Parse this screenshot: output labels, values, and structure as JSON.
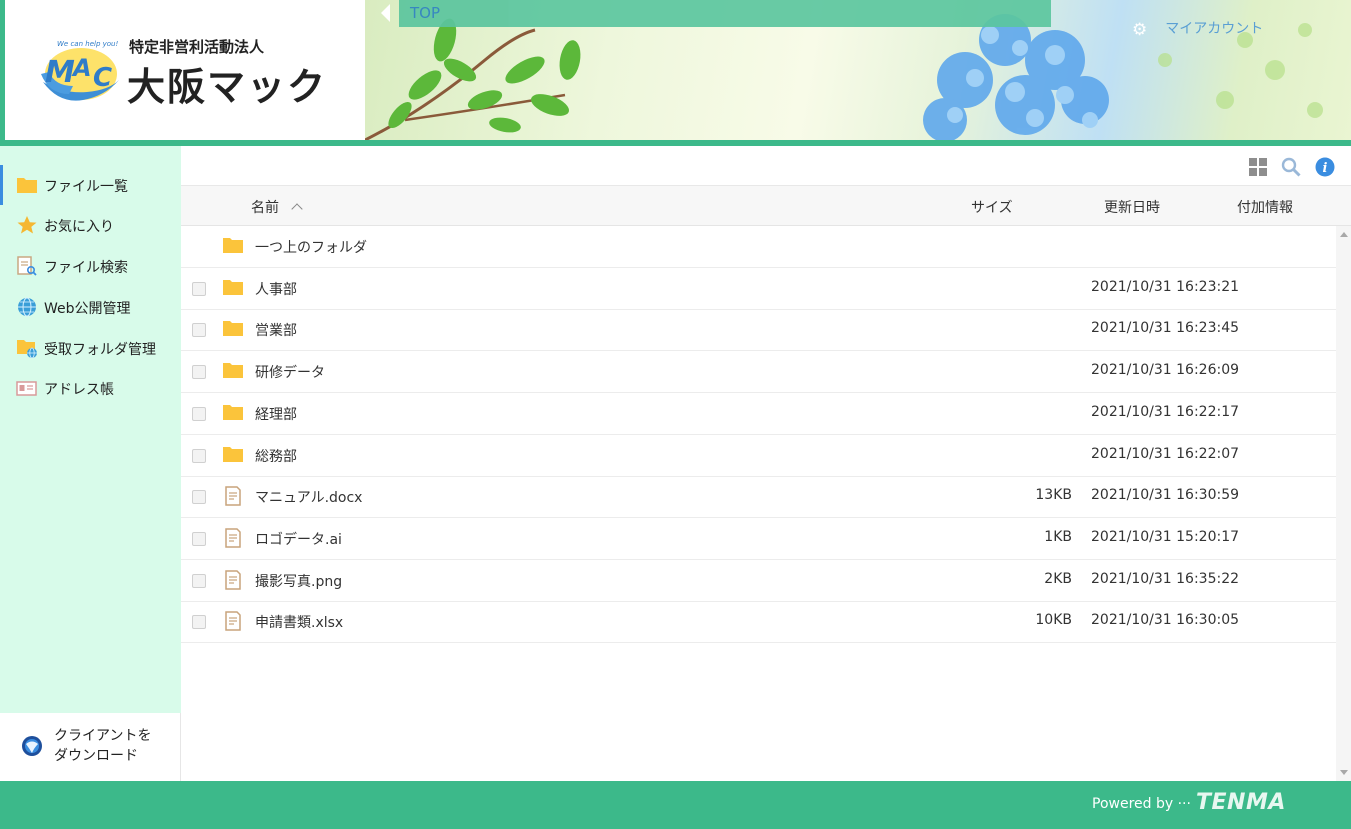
{
  "header": {
    "org_type": "特定非営利活動法人",
    "org_name": "大阪マック",
    "logo_tagline": "We can help you!",
    "top_label": "TOP",
    "account_label": "マイアカウント"
  },
  "sidebar": {
    "items": [
      {
        "label": "ファイル一覧",
        "icon": "folder-icon",
        "active": true
      },
      {
        "label": "お気に入り",
        "icon": "star-icon"
      },
      {
        "label": "ファイル検索",
        "icon": "file-search-icon"
      },
      {
        "label": "Web公開管理",
        "icon": "globe-icon"
      },
      {
        "label": "受取フォルダ管理",
        "icon": "inbox-folder-icon"
      },
      {
        "label": "アドレス帳",
        "icon": "address-book-icon"
      }
    ],
    "client_download": "クライアントをダウンロード"
  },
  "toolbar": {
    "icons": [
      "grid-view-icon",
      "search-icon",
      "info-icon"
    ]
  },
  "columns": {
    "name": "名前",
    "size": "サイズ",
    "updated": "更新日時",
    "extra": "付加情報"
  },
  "files": [
    {
      "name": "一つ上のフォルダ",
      "type": "folder",
      "size": "",
      "updated": "",
      "parent": true
    },
    {
      "name": "人事部",
      "type": "folder",
      "size": "",
      "updated": "2021/10/31 16:23:21"
    },
    {
      "name": "営業部",
      "type": "folder",
      "size": "",
      "updated": "2021/10/31 16:23:45"
    },
    {
      "name": "研修データ",
      "type": "folder",
      "size": "",
      "updated": "2021/10/31 16:26:09"
    },
    {
      "name": "経理部",
      "type": "folder",
      "size": "",
      "updated": "2021/10/31 16:22:17"
    },
    {
      "name": "総務部",
      "type": "folder",
      "size": "",
      "updated": "2021/10/31 16:22:07"
    },
    {
      "name": "マニュアル.docx",
      "type": "file",
      "size": "13KB",
      "updated": "2021/10/31 16:30:59"
    },
    {
      "name": "ロゴデータ.ai",
      "type": "file",
      "size": "1KB",
      "updated": "2021/10/31 15:20:17"
    },
    {
      "name": "撮影写真.png",
      "type": "file",
      "size": "2KB",
      "updated": "2021/10/31 16:35:22"
    },
    {
      "name": "申請書類.xlsx",
      "type": "file",
      "size": "10KB",
      "updated": "2021/10/31 16:30:05"
    }
  ],
  "footer": {
    "powered_by": "Powered by ···",
    "brand": "TENMA"
  },
  "colors": {
    "brand_green": "#3cb98a",
    "sidebar_bg": "#d8fbea",
    "folder_yellow": "#fbc43b",
    "accent_blue": "#3a8de0"
  }
}
